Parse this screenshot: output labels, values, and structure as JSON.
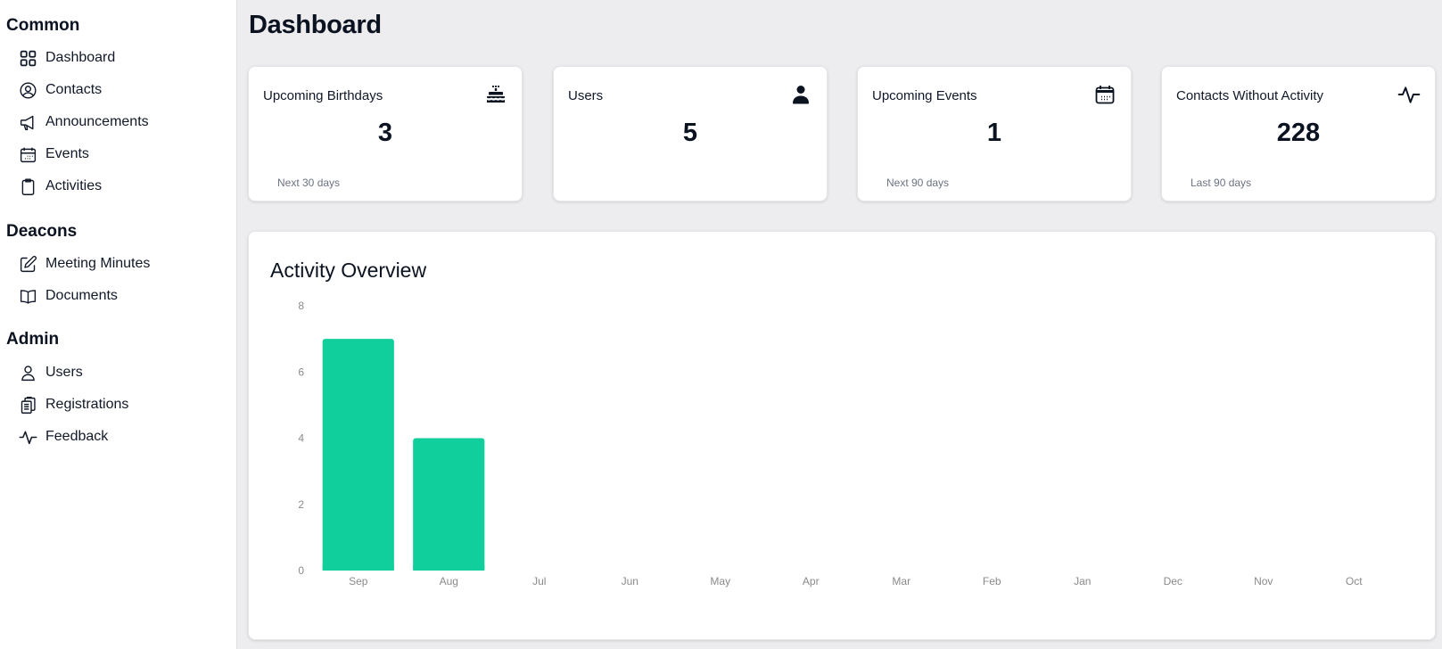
{
  "sidebar": {
    "sections": [
      {
        "title": "Common",
        "items": [
          {
            "label": "Dashboard",
            "icon": "dashboard-grid-icon"
          },
          {
            "label": "Contacts",
            "icon": "user-circle-icon"
          },
          {
            "label": "Announcements",
            "icon": "megaphone-icon"
          },
          {
            "label": "Events",
            "icon": "calendar-icon"
          },
          {
            "label": "Activities",
            "icon": "clipboard-icon"
          }
        ]
      },
      {
        "title": "Deacons",
        "items": [
          {
            "label": "Meeting Minutes",
            "icon": "pencil-square-icon"
          },
          {
            "label": "Documents",
            "icon": "book-open-icon"
          }
        ]
      },
      {
        "title": "Admin",
        "items": [
          {
            "label": "Users",
            "icon": "user-icon"
          },
          {
            "label": "Registrations",
            "icon": "clipboard-document-list-icon"
          },
          {
            "label": "Feedback",
            "icon": "activity-pulse-icon"
          }
        ]
      }
    ]
  },
  "page": {
    "title": "Dashboard"
  },
  "stats": [
    {
      "title": "Upcoming Birthdays",
      "value": "3",
      "subtitle": "Next 30 days",
      "icon": "birthday-cake-icon"
    },
    {
      "title": "Users",
      "value": "5",
      "subtitle": "",
      "icon": "user-solid-icon"
    },
    {
      "title": "Upcoming Events",
      "value": "1",
      "subtitle": "Next 90 days",
      "icon": "calendar-icon"
    },
    {
      "title": "Contacts Without Activity",
      "value": "228",
      "subtitle": "Last 90 days",
      "icon": "activity-pulse-icon"
    }
  ],
  "chart_card": {
    "title": "Activity Overview"
  },
  "colors": {
    "bar": "#10cf9c",
    "background": "#edecee",
    "card": "#ffffff",
    "muted_text": "#6b7280"
  },
  "chart_data": {
    "type": "bar",
    "title": "Activity Overview",
    "categories": [
      "Sep",
      "Aug",
      "Jul",
      "Jun",
      "May",
      "Apr",
      "Mar",
      "Feb",
      "Jan",
      "Dec",
      "Nov",
      "Oct"
    ],
    "values": [
      7,
      4,
      0,
      0,
      0,
      0,
      0,
      0,
      0,
      0,
      0,
      0
    ],
    "xlabel": "",
    "ylabel": "",
    "ylim": [
      0,
      8
    ],
    "yticks": [
      0,
      2,
      4,
      6,
      8
    ],
    "grid": false,
    "legend": "none"
  }
}
